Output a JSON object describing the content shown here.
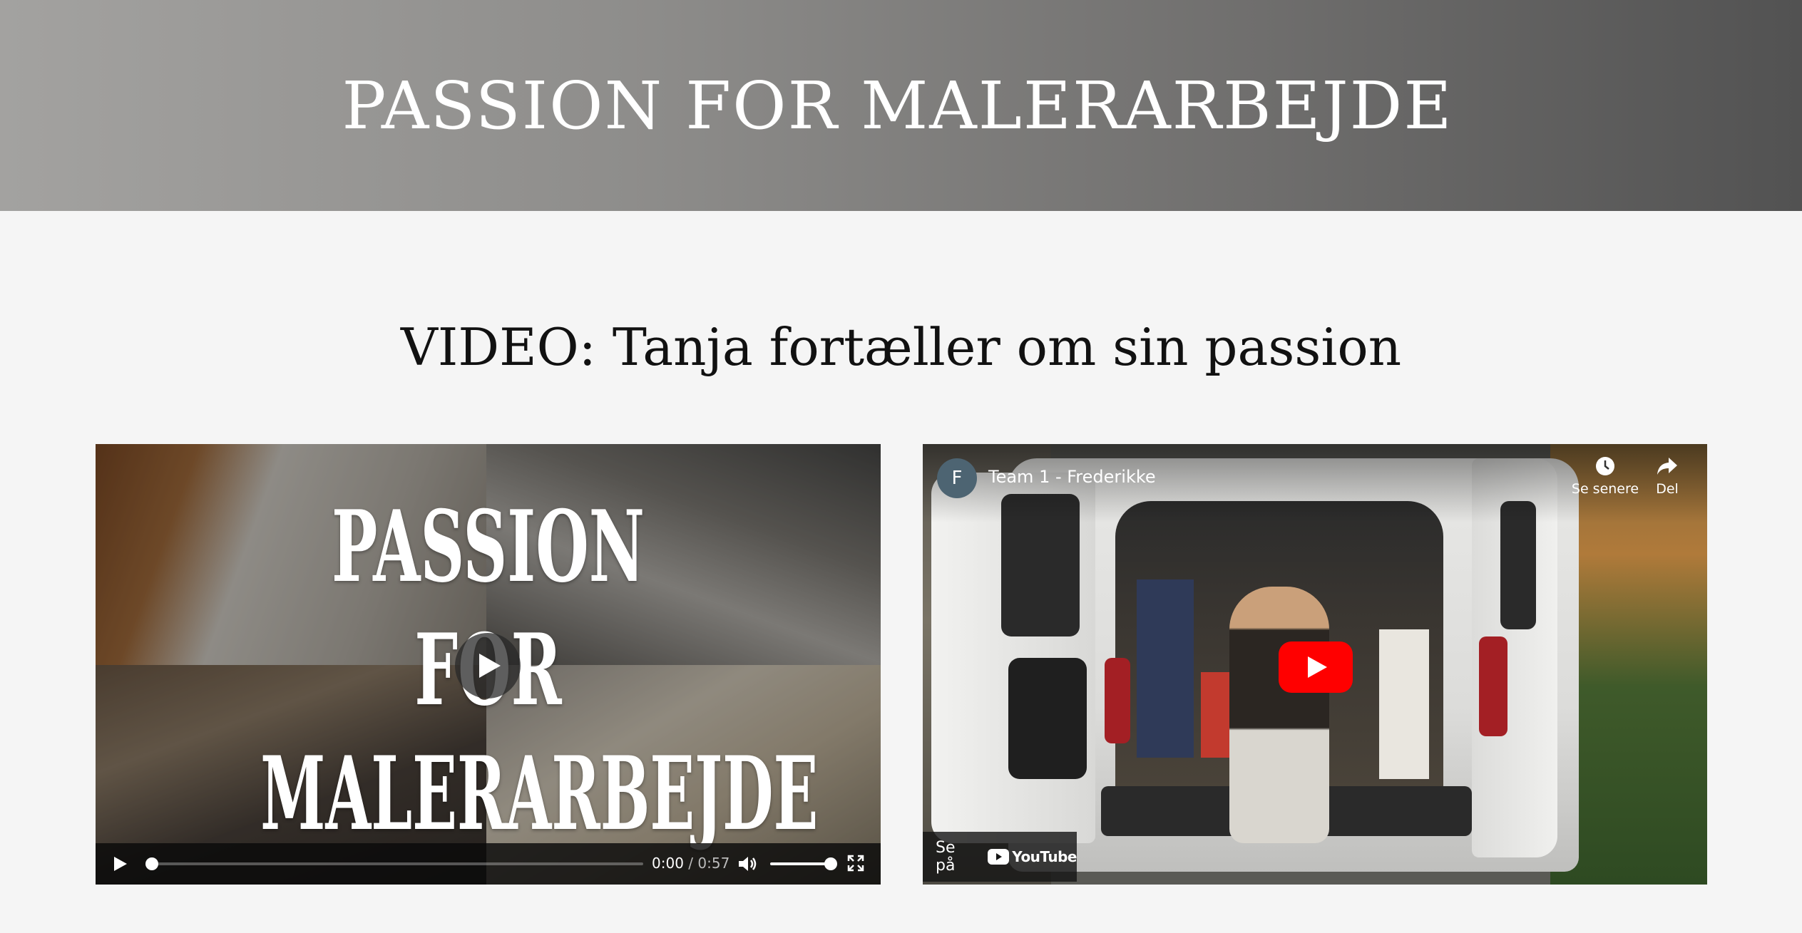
{
  "hero": {
    "title": "PASSION FOR MALERARBEJDE"
  },
  "section": {
    "title": "VIDEO: Tanja fortæller om sin passion"
  },
  "video_left": {
    "thumbnail_lines": [
      "PASSION",
      "FOR",
      "MALERARBEJDE"
    ],
    "controls": {
      "current_time": "0:00",
      "separator": "/",
      "duration": "0:57",
      "progress": 0,
      "volume": 1.0
    },
    "icons": [
      "play-icon",
      "volume-icon",
      "fullscreen-icon"
    ]
  },
  "video_right": {
    "channel_initial": "F",
    "title": "Team 1 - Frederikke",
    "watch_later_label": "Se senere",
    "share_label": "Del",
    "watch_on_label": "Se på",
    "youtube_logo_text": "YouTube",
    "colors": {
      "youtube_red": "#ff0000",
      "avatar": "#4d6472"
    }
  },
  "colors": {
    "background": "#f5f5f5",
    "hero_gradient_start": "#a3a2a0",
    "hero_gradient_end": "#525252",
    "title_text": "#111111"
  }
}
